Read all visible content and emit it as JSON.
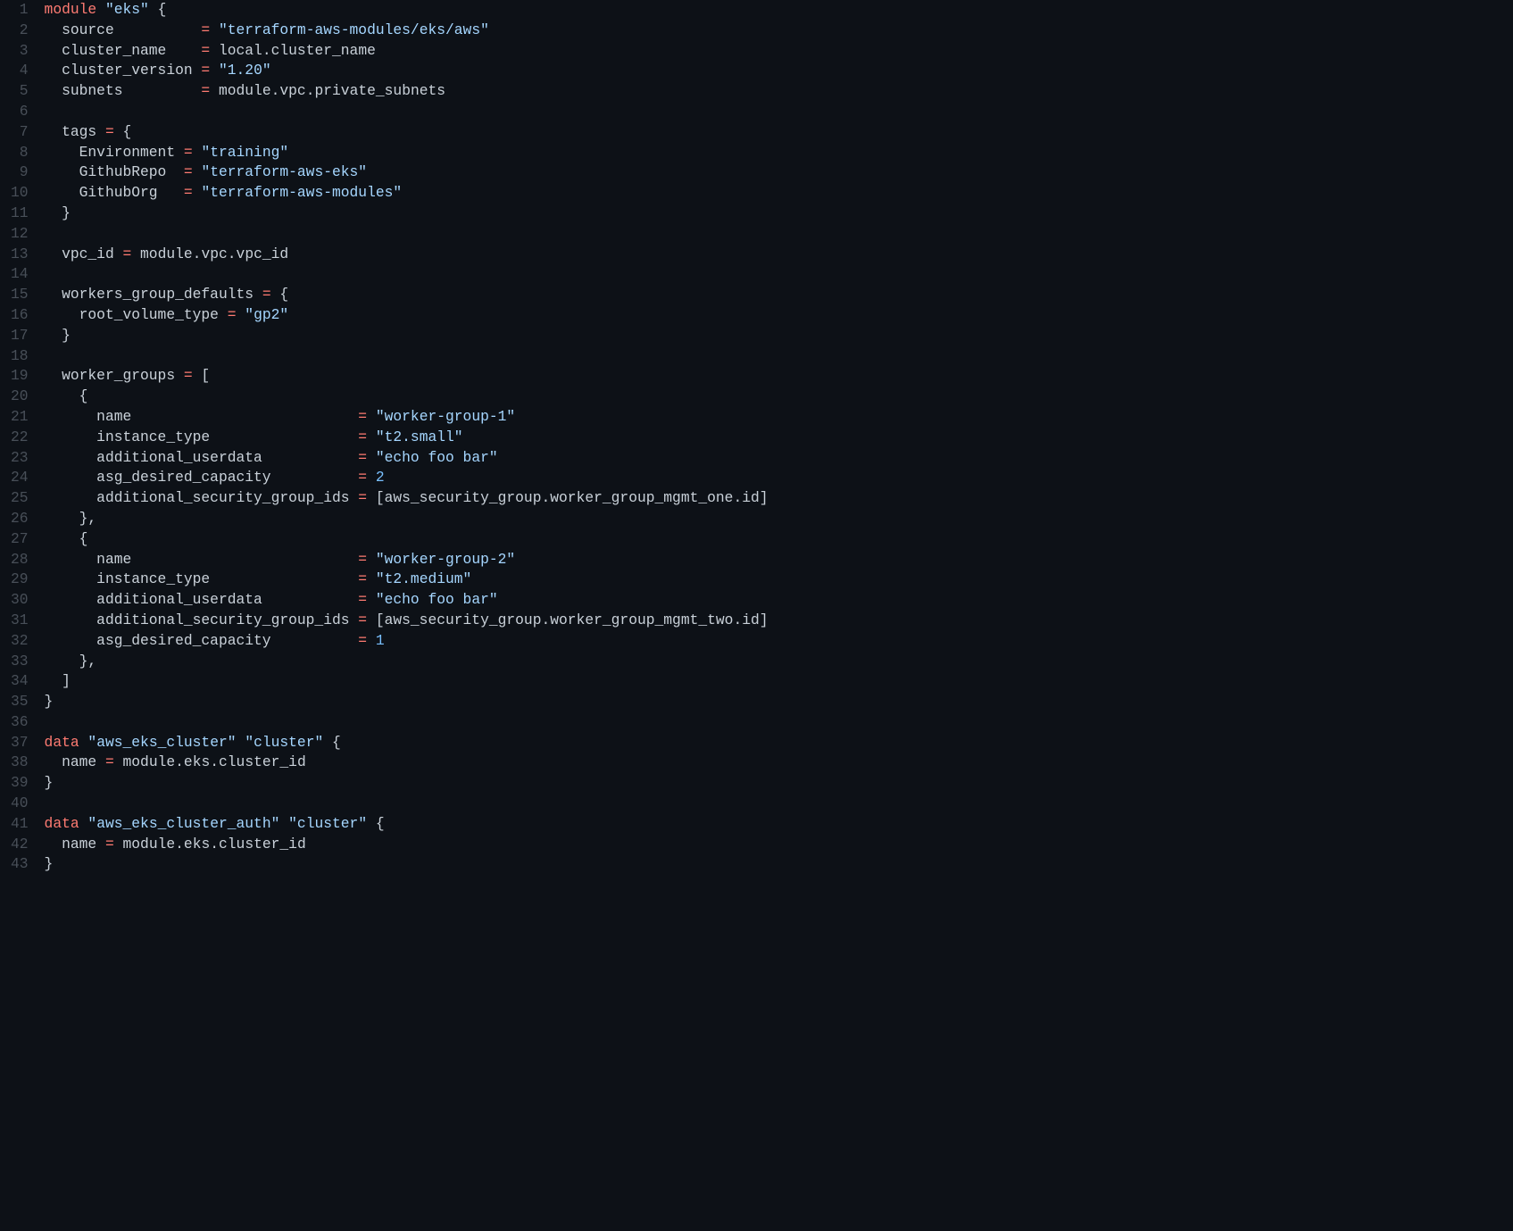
{
  "lines": [
    {
      "n": 1,
      "tokens": [
        {
          "t": "module",
          "c": "kw"
        },
        {
          "t": " ",
          "c": "punc"
        },
        {
          "t": "\"eks\"",
          "c": "str"
        },
        {
          "t": " {",
          "c": "punc"
        }
      ]
    },
    {
      "n": 2,
      "tokens": [
        {
          "t": "  source          ",
          "c": "prop"
        },
        {
          "t": "=",
          "c": "op"
        },
        {
          "t": " ",
          "c": "punc"
        },
        {
          "t": "\"terraform-aws-modules/eks/aws\"",
          "c": "str"
        }
      ]
    },
    {
      "n": 3,
      "tokens": [
        {
          "t": "  cluster_name    ",
          "c": "prop"
        },
        {
          "t": "=",
          "c": "op"
        },
        {
          "t": " local",
          "c": "punc"
        },
        {
          "t": ".",
          "c": "punc"
        },
        {
          "t": "cluster_name",
          "c": "punc"
        }
      ]
    },
    {
      "n": 4,
      "tokens": [
        {
          "t": "  cluster_version ",
          "c": "prop"
        },
        {
          "t": "=",
          "c": "op"
        },
        {
          "t": " ",
          "c": "punc"
        },
        {
          "t": "\"1.20\"",
          "c": "str"
        }
      ]
    },
    {
      "n": 5,
      "tokens": [
        {
          "t": "  subnets         ",
          "c": "prop"
        },
        {
          "t": "=",
          "c": "op"
        },
        {
          "t": " module",
          "c": "punc"
        },
        {
          "t": ".",
          "c": "punc"
        },
        {
          "t": "vpc",
          "c": "punc"
        },
        {
          "t": ".",
          "c": "punc"
        },
        {
          "t": "private_subnets",
          "c": "punc"
        }
      ]
    },
    {
      "n": 6,
      "tokens": []
    },
    {
      "n": 7,
      "tokens": [
        {
          "t": "  tags ",
          "c": "prop"
        },
        {
          "t": "=",
          "c": "op"
        },
        {
          "t": " {",
          "c": "punc"
        }
      ]
    },
    {
      "n": 8,
      "tokens": [
        {
          "t": "    Environment ",
          "c": "prop"
        },
        {
          "t": "=",
          "c": "op"
        },
        {
          "t": " ",
          "c": "punc"
        },
        {
          "t": "\"training\"",
          "c": "str"
        }
      ]
    },
    {
      "n": 9,
      "tokens": [
        {
          "t": "    GithubRepo  ",
          "c": "prop"
        },
        {
          "t": "=",
          "c": "op"
        },
        {
          "t": " ",
          "c": "punc"
        },
        {
          "t": "\"terraform-aws-eks\"",
          "c": "str"
        }
      ]
    },
    {
      "n": 10,
      "tokens": [
        {
          "t": "    GithubOrg   ",
          "c": "prop"
        },
        {
          "t": "=",
          "c": "op"
        },
        {
          "t": " ",
          "c": "punc"
        },
        {
          "t": "\"terraform-aws-modules\"",
          "c": "str"
        }
      ]
    },
    {
      "n": 11,
      "tokens": [
        {
          "t": "  }",
          "c": "punc"
        }
      ]
    },
    {
      "n": 12,
      "tokens": []
    },
    {
      "n": 13,
      "tokens": [
        {
          "t": "  vpc_id ",
          "c": "prop"
        },
        {
          "t": "=",
          "c": "op"
        },
        {
          "t": " module",
          "c": "punc"
        },
        {
          "t": ".",
          "c": "punc"
        },
        {
          "t": "vpc",
          "c": "punc"
        },
        {
          "t": ".",
          "c": "punc"
        },
        {
          "t": "vpc_id",
          "c": "punc"
        }
      ]
    },
    {
      "n": 14,
      "tokens": []
    },
    {
      "n": 15,
      "tokens": [
        {
          "t": "  workers_group_defaults ",
          "c": "prop"
        },
        {
          "t": "=",
          "c": "op"
        },
        {
          "t": " {",
          "c": "punc"
        }
      ]
    },
    {
      "n": 16,
      "tokens": [
        {
          "t": "    root_volume_type ",
          "c": "prop"
        },
        {
          "t": "=",
          "c": "op"
        },
        {
          "t": " ",
          "c": "punc"
        },
        {
          "t": "\"gp2\"",
          "c": "str"
        }
      ]
    },
    {
      "n": 17,
      "tokens": [
        {
          "t": "  }",
          "c": "punc"
        }
      ]
    },
    {
      "n": 18,
      "tokens": []
    },
    {
      "n": 19,
      "tokens": [
        {
          "t": "  worker_groups ",
          "c": "prop"
        },
        {
          "t": "=",
          "c": "op"
        },
        {
          "t": " [",
          "c": "punc"
        }
      ]
    },
    {
      "n": 20,
      "tokens": [
        {
          "t": "    {",
          "c": "punc"
        }
      ]
    },
    {
      "n": 21,
      "tokens": [
        {
          "t": "      name                          ",
          "c": "prop"
        },
        {
          "t": "=",
          "c": "op"
        },
        {
          "t": " ",
          "c": "punc"
        },
        {
          "t": "\"worker-group-1\"",
          "c": "str"
        }
      ]
    },
    {
      "n": 22,
      "tokens": [
        {
          "t": "      instance_type                 ",
          "c": "prop"
        },
        {
          "t": "=",
          "c": "op"
        },
        {
          "t": " ",
          "c": "punc"
        },
        {
          "t": "\"t2.small\"",
          "c": "str"
        }
      ]
    },
    {
      "n": 23,
      "tokens": [
        {
          "t": "      additional_userdata           ",
          "c": "prop"
        },
        {
          "t": "=",
          "c": "op"
        },
        {
          "t": " ",
          "c": "punc"
        },
        {
          "t": "\"echo foo bar\"",
          "c": "str"
        }
      ]
    },
    {
      "n": 24,
      "tokens": [
        {
          "t": "      asg_desired_capacity          ",
          "c": "prop"
        },
        {
          "t": "=",
          "c": "op"
        },
        {
          "t": " ",
          "c": "punc"
        },
        {
          "t": "2",
          "c": "num"
        }
      ]
    },
    {
      "n": 25,
      "tokens": [
        {
          "t": "      additional_security_group_ids ",
          "c": "prop"
        },
        {
          "t": "=",
          "c": "op"
        },
        {
          "t": " [aws_security_group",
          "c": "punc"
        },
        {
          "t": ".",
          "c": "punc"
        },
        {
          "t": "worker_group_mgmt_one",
          "c": "punc"
        },
        {
          "t": ".",
          "c": "punc"
        },
        {
          "t": "id]",
          "c": "punc"
        }
      ]
    },
    {
      "n": 26,
      "tokens": [
        {
          "t": "    },",
          "c": "punc"
        }
      ]
    },
    {
      "n": 27,
      "tokens": [
        {
          "t": "    {",
          "c": "punc"
        }
      ]
    },
    {
      "n": 28,
      "tokens": [
        {
          "t": "      name                          ",
          "c": "prop"
        },
        {
          "t": "=",
          "c": "op"
        },
        {
          "t": " ",
          "c": "punc"
        },
        {
          "t": "\"worker-group-2\"",
          "c": "str"
        }
      ]
    },
    {
      "n": 29,
      "tokens": [
        {
          "t": "      instance_type                 ",
          "c": "prop"
        },
        {
          "t": "=",
          "c": "op"
        },
        {
          "t": " ",
          "c": "punc"
        },
        {
          "t": "\"t2.medium\"",
          "c": "str"
        }
      ]
    },
    {
      "n": 30,
      "tokens": [
        {
          "t": "      additional_userdata           ",
          "c": "prop"
        },
        {
          "t": "=",
          "c": "op"
        },
        {
          "t": " ",
          "c": "punc"
        },
        {
          "t": "\"echo foo bar\"",
          "c": "str"
        }
      ]
    },
    {
      "n": 31,
      "tokens": [
        {
          "t": "      additional_security_group_ids ",
          "c": "prop"
        },
        {
          "t": "=",
          "c": "op"
        },
        {
          "t": " [aws_security_group",
          "c": "punc"
        },
        {
          "t": ".",
          "c": "punc"
        },
        {
          "t": "worker_group_mgmt_two",
          "c": "punc"
        },
        {
          "t": ".",
          "c": "punc"
        },
        {
          "t": "id]",
          "c": "punc"
        }
      ]
    },
    {
      "n": 32,
      "tokens": [
        {
          "t": "      asg_desired_capacity          ",
          "c": "prop"
        },
        {
          "t": "=",
          "c": "op"
        },
        {
          "t": " ",
          "c": "punc"
        },
        {
          "t": "1",
          "c": "num"
        }
      ]
    },
    {
      "n": 33,
      "tokens": [
        {
          "t": "    },",
          "c": "punc"
        }
      ]
    },
    {
      "n": 34,
      "tokens": [
        {
          "t": "  ]",
          "c": "punc"
        }
      ]
    },
    {
      "n": 35,
      "tokens": [
        {
          "t": "}",
          "c": "punc"
        }
      ]
    },
    {
      "n": 36,
      "tokens": []
    },
    {
      "n": 37,
      "tokens": [
        {
          "t": "data",
          "c": "kw"
        },
        {
          "t": " ",
          "c": "punc"
        },
        {
          "t": "\"aws_eks_cluster\"",
          "c": "str"
        },
        {
          "t": " ",
          "c": "punc"
        },
        {
          "t": "\"cluster\"",
          "c": "str"
        },
        {
          "t": " {",
          "c": "punc"
        }
      ]
    },
    {
      "n": 38,
      "tokens": [
        {
          "t": "  name ",
          "c": "prop"
        },
        {
          "t": "=",
          "c": "op"
        },
        {
          "t": " module",
          "c": "punc"
        },
        {
          "t": ".",
          "c": "punc"
        },
        {
          "t": "eks",
          "c": "punc"
        },
        {
          "t": ".",
          "c": "punc"
        },
        {
          "t": "cluster_id",
          "c": "punc"
        }
      ]
    },
    {
      "n": 39,
      "tokens": [
        {
          "t": "}",
          "c": "punc"
        }
      ]
    },
    {
      "n": 40,
      "tokens": []
    },
    {
      "n": 41,
      "tokens": [
        {
          "t": "data",
          "c": "kw"
        },
        {
          "t": " ",
          "c": "punc"
        },
        {
          "t": "\"aws_eks_cluster_auth\"",
          "c": "str"
        },
        {
          "t": " ",
          "c": "punc"
        },
        {
          "t": "\"cluster\"",
          "c": "str"
        },
        {
          "t": " {",
          "c": "punc"
        }
      ]
    },
    {
      "n": 42,
      "tokens": [
        {
          "t": "  name ",
          "c": "prop"
        },
        {
          "t": "=",
          "c": "op"
        },
        {
          "t": " module",
          "c": "punc"
        },
        {
          "t": ".",
          "c": "punc"
        },
        {
          "t": "eks",
          "c": "punc"
        },
        {
          "t": ".",
          "c": "punc"
        },
        {
          "t": "cluster_id",
          "c": "punc"
        }
      ]
    },
    {
      "n": 43,
      "tokens": [
        {
          "t": "}",
          "c": "punc"
        }
      ]
    }
  ]
}
